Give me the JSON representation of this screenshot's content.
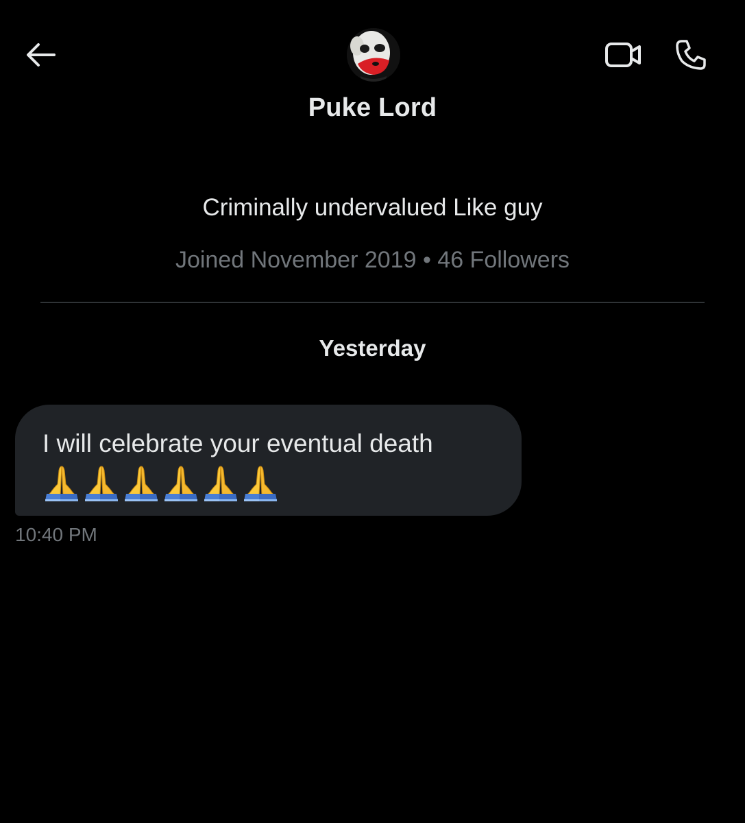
{
  "header": {
    "back_icon": "arrow-left-icon",
    "video_icon": "video-camera-icon",
    "call_icon": "phone-icon"
  },
  "profile": {
    "display_name": "Puke Lord",
    "bio": "Criminally undervalued Like guy",
    "meta": "Joined November 2019 • 46 Followers",
    "avatar_icon": "joker-face-avatar"
  },
  "conversation": {
    "date_separator": "Yesterday",
    "messages": [
      {
        "text": "I will celebrate your eventual death",
        "emoji_name": "folded-hands-emoji",
        "emoji_count": 6,
        "time": "10:40 PM"
      }
    ]
  },
  "colors": {
    "background": "#000000",
    "primary_text": "#e7e9ea",
    "secondary_text": "#71767b",
    "bubble_bg": "#202327",
    "divider": "#2f3336"
  }
}
